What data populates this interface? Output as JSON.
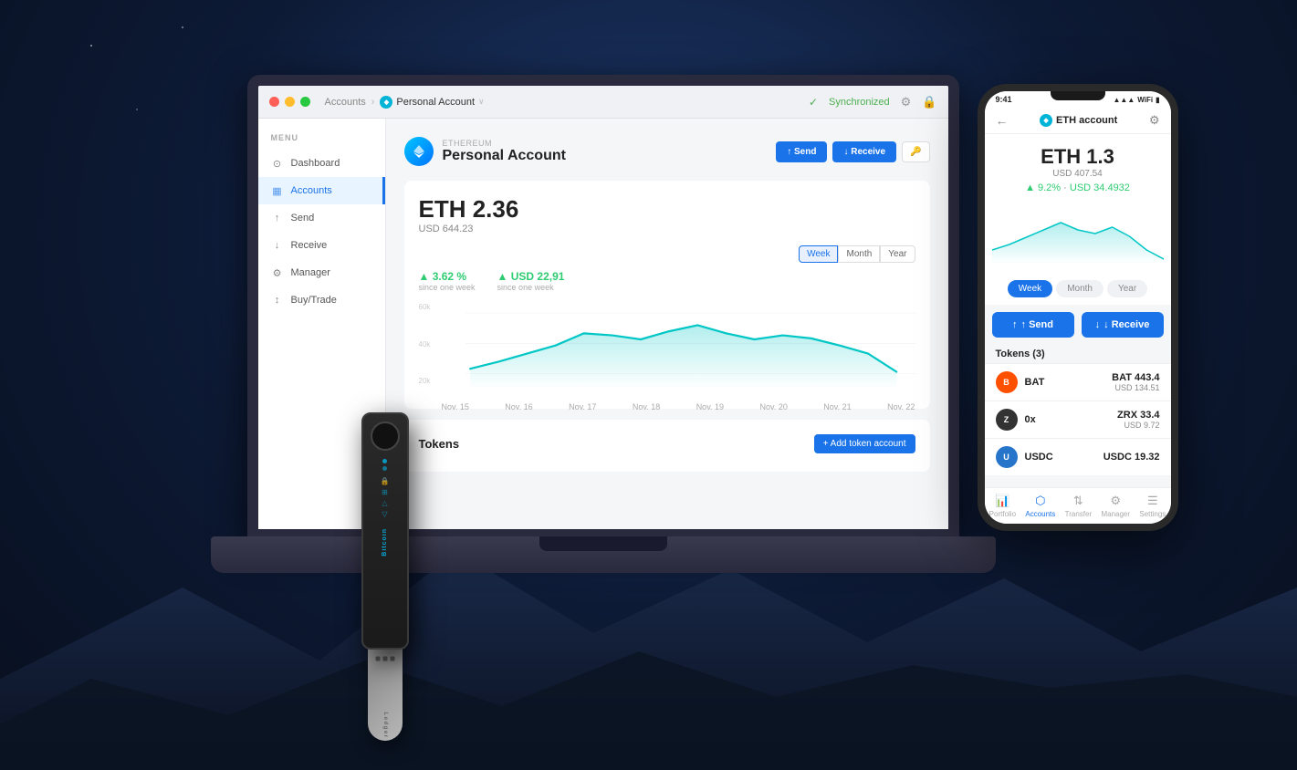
{
  "background": {
    "color": "#0d1a35"
  },
  "laptop": {
    "titlebar": {
      "breadcrumb_accounts": "Accounts",
      "breadcrumb_account": "Personal Account",
      "sync_status": "Synchronized",
      "chevron": "›"
    },
    "sidebar": {
      "menu_label": "MENU",
      "items": [
        {
          "id": "dashboard",
          "label": "Dashboard",
          "icon": "⊙",
          "active": false
        },
        {
          "id": "accounts",
          "label": "Accounts",
          "icon": "▦",
          "active": true
        },
        {
          "id": "send",
          "label": "Send",
          "icon": "↑",
          "active": false
        },
        {
          "id": "receive",
          "label": "Receive",
          "icon": "↓",
          "active": false
        },
        {
          "id": "manager",
          "label": "Manager",
          "icon": "⚙",
          "active": false
        },
        {
          "id": "buytrade",
          "label": "Buy/Trade",
          "icon": "↕",
          "active": false
        }
      ]
    },
    "main": {
      "account_subtitle": "ETHEREUM",
      "account_name": "Personal Account",
      "buttons": {
        "send": "↑ Send",
        "receive": "↓ Receive"
      },
      "balance_eth": "ETH 2.36",
      "balance_usd": "USD 644.23",
      "period_buttons": [
        "Week",
        "Month",
        "Year"
      ],
      "active_period": "Week",
      "stats": [
        {
          "label": "since one week",
          "value": "▲ 3.62 %",
          "type": "percent"
        },
        {
          "label": "since one week",
          "value": "▲ USD 22,91",
          "type": "usd"
        }
      ],
      "chart": {
        "y_labels": [
          "60k",
          "40k",
          "20k"
        ],
        "x_labels": [
          "Nov. 15",
          "Nov. 16",
          "Nov. 17",
          "Nov. 18",
          "Nov. 19",
          "Nov. 20",
          "Nov. 21",
          "Nov. 22"
        ],
        "data_points": [
          22,
          28,
          35,
          45,
          55,
          52,
          48,
          58,
          62,
          55,
          48,
          52,
          50,
          45,
          42,
          38,
          40,
          35,
          30,
          25
        ]
      },
      "tokens_title": "Tokens",
      "add_token_btn": "+ Add token account"
    }
  },
  "phone": {
    "status_bar": {
      "time": "9:41",
      "signal": "●●●",
      "wifi": "WiFi",
      "battery": "■"
    },
    "header": {
      "back_icon": "←",
      "title": "ETH account",
      "settings_icon": "⚙"
    },
    "balance_eth": "ETH 1.3",
    "balance_usd": "USD 407.54",
    "change_percent": "▲ 9.2%",
    "change_usd": "USD 34.4932",
    "period_buttons": [
      "Week",
      "Month",
      "Year"
    ],
    "active_period": "Week",
    "send_btn": "↑ Send",
    "receive_btn": "↓ Receive",
    "tokens_header": "Tokens (3)",
    "tokens": [
      {
        "id": "bat",
        "symbol": "B",
        "name": "BAT",
        "amount": "BAT 443.4",
        "usd": "USD 134.51",
        "color": "#ff5000"
      },
      {
        "id": "zrx",
        "symbol": "Z",
        "name": "0x",
        "amount": "ZRX 33.4",
        "usd": "USD 9.72",
        "color": "#333"
      },
      {
        "id": "usdc",
        "symbol": "U",
        "name": "USDC",
        "amount": "USDC 19.32",
        "usd": "",
        "color": "#2775ca"
      }
    ],
    "bottom_nav": [
      {
        "id": "portfolio",
        "label": "Portfolio",
        "icon": "📊"
      },
      {
        "id": "accounts",
        "label": "Accounts",
        "icon": "⬡",
        "active": true
      },
      {
        "id": "transfer",
        "label": "Transfer",
        "icon": "⇅"
      },
      {
        "id": "manager",
        "label": "Manager",
        "icon": "⚙"
      },
      {
        "id": "settings",
        "label": "Settings",
        "icon": "☰"
      }
    ]
  }
}
